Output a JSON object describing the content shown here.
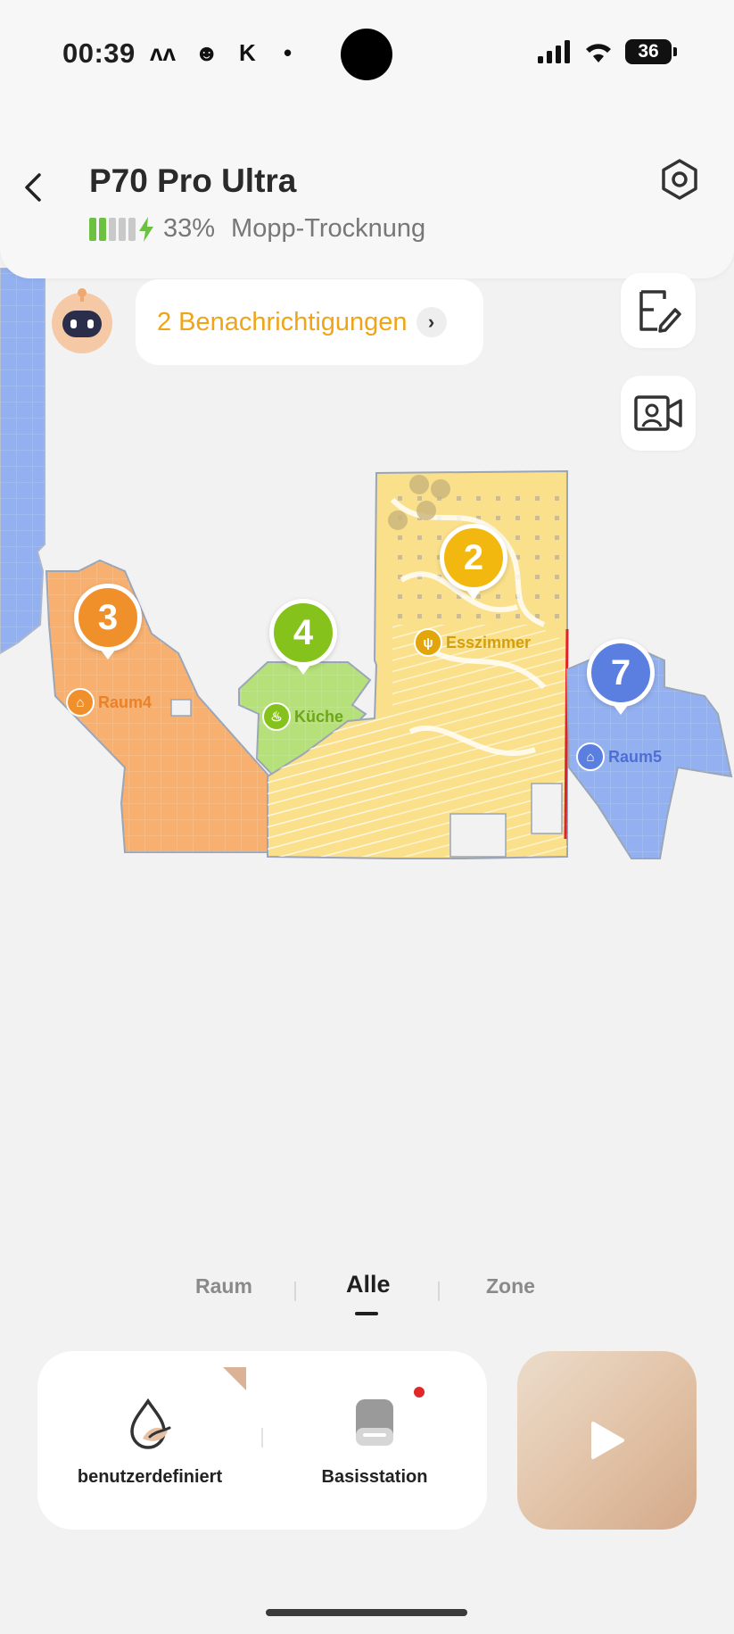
{
  "status_bar": {
    "time": "00:39",
    "notification_icons": [
      "ʌʌ",
      "☻",
      "K",
      "•"
    ],
    "battery_level": "36"
  },
  "header": {
    "back_icon": "chevron-left-icon",
    "device_name": "P70 Pro Ultra",
    "battery_percent": "33%",
    "battery_fill_fraction": 0.4,
    "status_text": "Mopp-Trocknung",
    "settings_icon": "hexagon-gear-icon"
  },
  "notification": {
    "text": "2 Benachrichtigungen",
    "chevron": "›"
  },
  "map": {
    "rooms": [
      {
        "number": "3",
        "name": "Raum4",
        "color": "#f0902a",
        "fill": "#f7b06f",
        "icon": "home-icon"
      },
      {
        "number": "4",
        "name": "Küche",
        "color": "#86c21c",
        "fill": "#b5e07a",
        "icon": "pot-icon"
      },
      {
        "number": "2",
        "name": "Esszimmer",
        "color": "#f2b80f",
        "fill": "#fae08a",
        "icon": "fork-knife-icon"
      },
      {
        "number": "7",
        "name": "Raum5",
        "color": "#5a7fe0",
        "fill": "#9ab4f2",
        "icon": "home-icon"
      }
    ],
    "corridor_color": "#93b0f0"
  },
  "tabs": {
    "items": [
      "Raum",
      "Alle",
      "Zone"
    ],
    "active": "Alle"
  },
  "bottom": {
    "mode_label": "benutzerdefiniert",
    "station_label": "Basisstation",
    "play_icon": "play-icon",
    "accent": "#d9b193"
  }
}
